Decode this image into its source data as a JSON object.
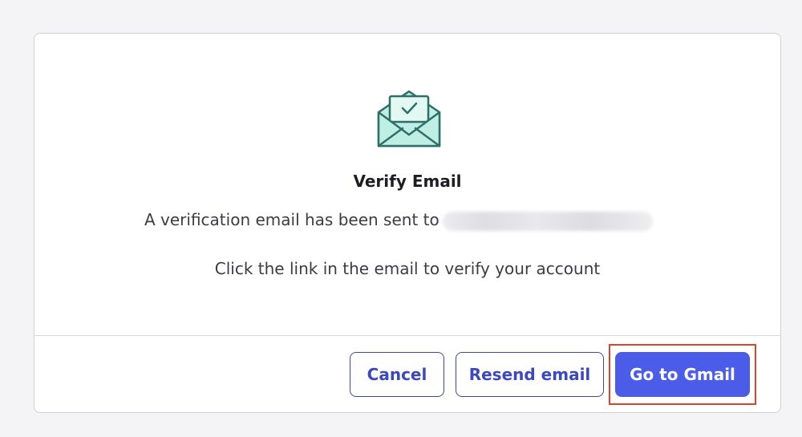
{
  "dialog": {
    "icon": "envelope-check-icon",
    "title": "Verify Email",
    "sent_text": "A verification email has been sent to",
    "hint": "Click the link in the email to verify your account"
  },
  "actions": {
    "cancel_label": "Cancel",
    "resend_label": "Resend email",
    "gmail_label": "Go to Gmail"
  },
  "colors": {
    "primary": "#4a5ce8",
    "outline": "#3b48a8",
    "highlight": "#d9442c",
    "envelope_fill": "#bfeee4",
    "envelope_stroke": "#2e6f68"
  }
}
